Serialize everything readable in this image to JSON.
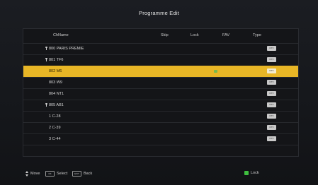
{
  "title": "Programme Edit",
  "columns": {
    "chname": "ChName",
    "skip": "Skip",
    "lock": "Lock",
    "fav": "FAV",
    "type": "Type"
  },
  "rows": [
    {
      "name": "800 PARIS PREMIE",
      "key": true,
      "lock": false,
      "type": "DTV",
      "selected": false
    },
    {
      "name": "801 TF6",
      "key": true,
      "lock": false,
      "type": "DTV",
      "selected": false
    },
    {
      "name": "802 M6",
      "key": false,
      "lock": true,
      "type": "DTV",
      "selected": true
    },
    {
      "name": "803 W9",
      "key": false,
      "lock": false,
      "type": "DTV",
      "selected": false
    },
    {
      "name": "804 NT1",
      "key": false,
      "lock": false,
      "type": "DTV",
      "selected": false
    },
    {
      "name": "805 AB1",
      "key": true,
      "lock": false,
      "type": "DTV",
      "selected": false
    },
    {
      "name": "1 C-28",
      "key": false,
      "lock": false,
      "type": "DTV",
      "selected": false
    },
    {
      "name": "2 C-39",
      "key": false,
      "lock": false,
      "type": "DTV",
      "selected": false
    },
    {
      "name": "3 C-44",
      "key": false,
      "lock": false,
      "type": "DTV",
      "selected": false
    }
  ],
  "footer": {
    "move": "Move",
    "select_key": "OK",
    "select": "Select",
    "back_key": "EXIT",
    "back": "Back",
    "lock": "Lock"
  }
}
